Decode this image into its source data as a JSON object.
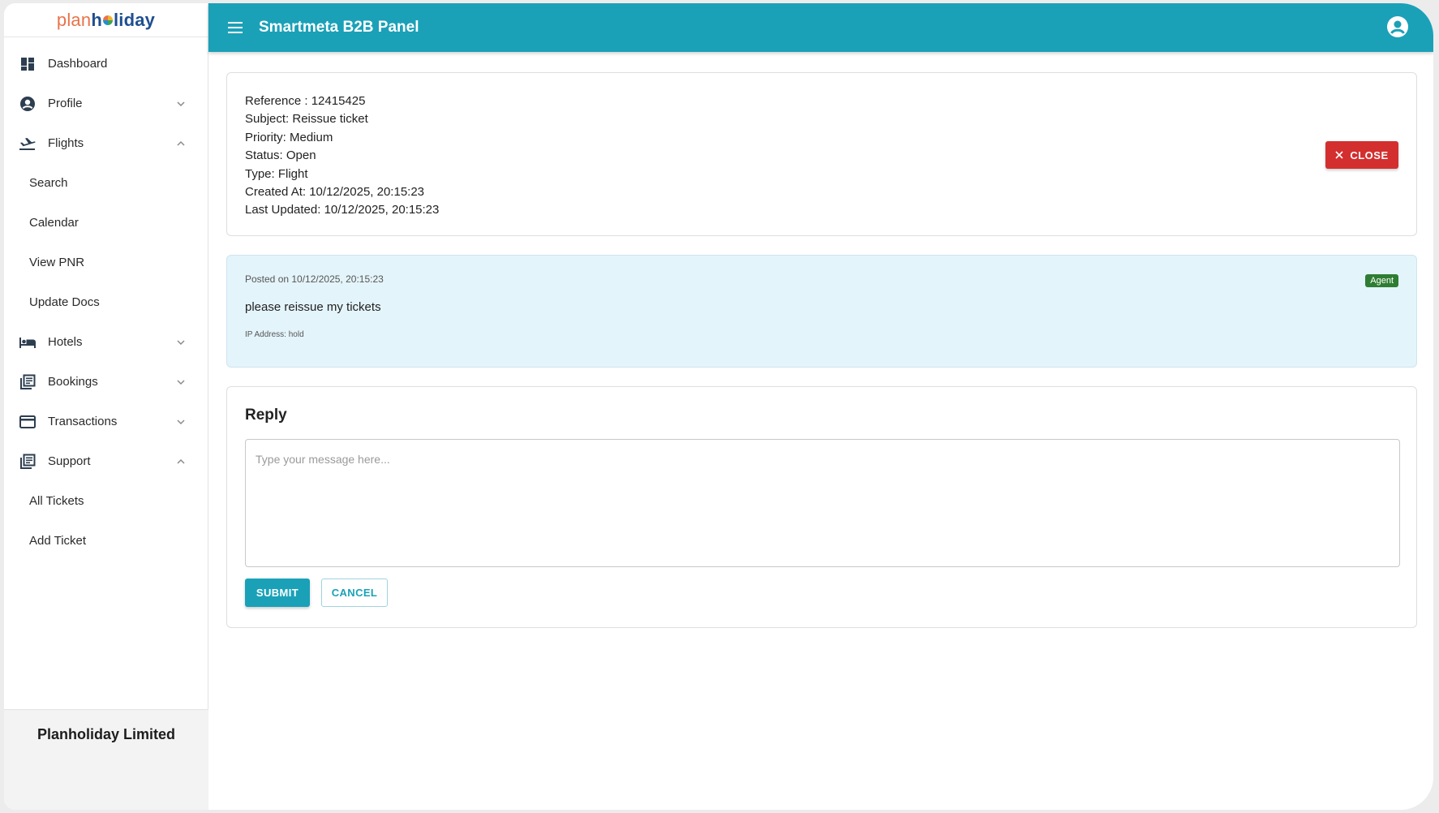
{
  "brand": {
    "part1": "plan",
    "part2_a": "h",
    "part2_b": "liday"
  },
  "header": {
    "title": "Smartmeta B2B Panel"
  },
  "sidebar": {
    "items": [
      {
        "label": "Dashboard",
        "icon": "dashboard-icon"
      },
      {
        "label": "Profile",
        "icon": "account-circle-icon",
        "chevron": "down"
      },
      {
        "label": "Flights",
        "icon": "flight-takeoff-icon",
        "chevron": "up",
        "children": [
          "Search",
          "Calendar",
          "View PNR",
          "Update Docs"
        ]
      },
      {
        "label": "Hotels",
        "icon": "hotel-bed-icon",
        "chevron": "down"
      },
      {
        "label": "Bookings",
        "icon": "library-books-icon",
        "chevron": "down"
      },
      {
        "label": "Transactions",
        "icon": "credit-card-icon",
        "chevron": "down"
      },
      {
        "label": "Support",
        "icon": "library-books-icon",
        "chevron": "up",
        "children": [
          "All Tickets",
          "Add Ticket"
        ]
      }
    ],
    "footer": "Planholiday Limited"
  },
  "ticket": {
    "reference": "Reference : 12415425",
    "subject": "Subject: Reissue ticket",
    "priority": "Priority: Medium",
    "status": "Status: Open",
    "type": "Type: Flight",
    "created_at": "Created At: 10/12/2025, 20:15:23",
    "last_updated": "Last Updated: 10/12/2025, 20:15:23",
    "close_label": "CLOSE"
  },
  "message": {
    "posted": "Posted on 10/12/2025, 20:15:23",
    "badge": "Agent",
    "body": "please reissue my tickets",
    "ip": "IP Address: hold"
  },
  "reply": {
    "title": "Reply",
    "placeholder": "Type your message here...",
    "submit_label": "SUBMIT",
    "cancel_label": "CANCEL"
  },
  "colors": {
    "primary": "#1aa1b8",
    "danger": "#d32f2f",
    "agent_badge": "#2e7d32",
    "message_bg": "#e4f4fb"
  }
}
